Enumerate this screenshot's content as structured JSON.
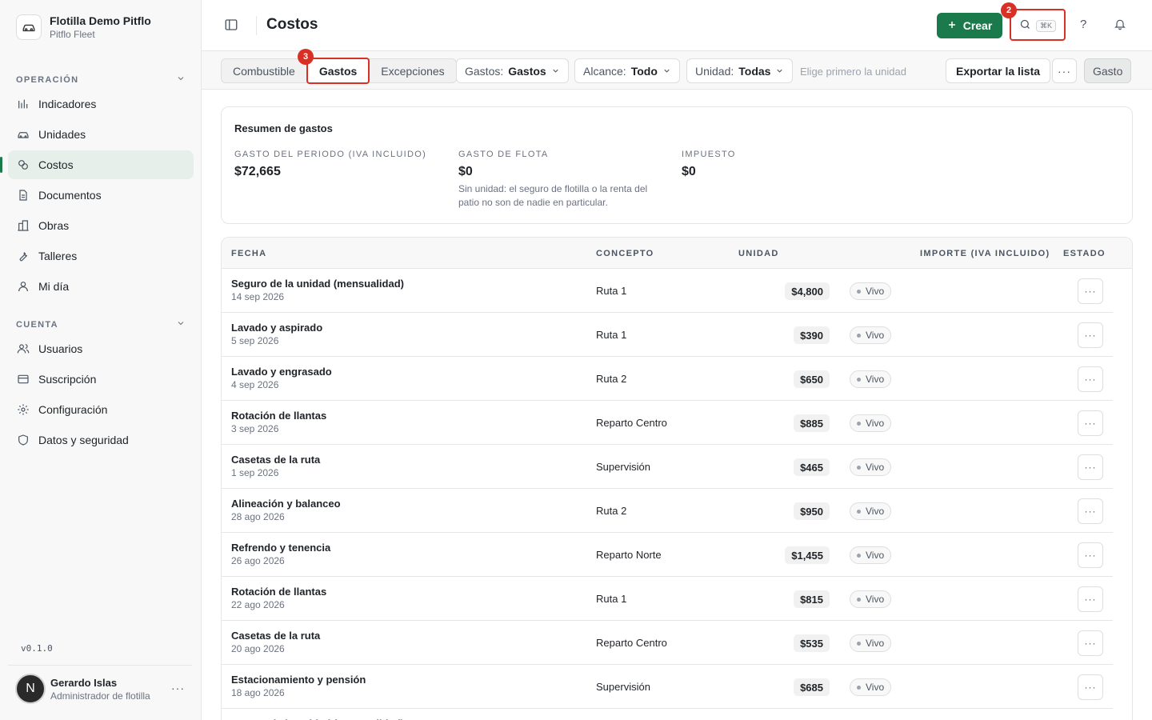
{
  "app": {
    "org_name": "Flotilla Demo Pitflo",
    "org_sub": "Pitflo Fleet",
    "version": "v0.1.0"
  },
  "sidebar": {
    "sections": [
      {
        "title": "OPERACIÓN",
        "items": [
          {
            "label": "Indicadores",
            "icon": "chart-icon",
            "active": false
          },
          {
            "label": "Unidades",
            "icon": "car-icon",
            "active": false
          },
          {
            "label": "Costos",
            "icon": "coins-icon",
            "active": true
          },
          {
            "label": "Documentos",
            "icon": "document-icon",
            "active": false
          },
          {
            "label": "Obras",
            "icon": "building-icon",
            "active": false
          },
          {
            "label": "Talleres",
            "icon": "wrench-icon",
            "active": false
          },
          {
            "label": "Mi día",
            "icon": "person-icon",
            "active": false
          }
        ]
      },
      {
        "title": "CUENTA",
        "items": [
          {
            "label": "Usuarios",
            "icon": "users-icon",
            "active": false
          },
          {
            "label": "Suscripción",
            "icon": "card-icon",
            "active": false
          },
          {
            "label": "Configuración",
            "icon": "gear-icon",
            "active": false
          },
          {
            "label": "Datos y seguridad",
            "icon": "shield-icon",
            "active": false
          }
        ]
      }
    ],
    "user": {
      "initial": "N",
      "name": "Gerardo Islas",
      "role": "Administrador de flotilla",
      "more": "···"
    }
  },
  "header": {
    "title": "Costos",
    "create_label": "Crear",
    "search_shortcut": "⌘K",
    "help_label": "?",
    "search_badge": "2",
    "tab_badge": "3"
  },
  "toolbar": {
    "tabs": [
      "Combustible",
      "Gastos",
      "Excepciones"
    ],
    "active_tab": "Gastos",
    "filters": [
      {
        "label": "Gastos:",
        "value": "Gastos"
      },
      {
        "label": "Alcance:",
        "value": "Todo"
      },
      {
        "label": "Unidad:",
        "value": "Todas"
      }
    ],
    "hint": "Elige primero la unidad",
    "export_label": "Exportar la lista",
    "more_label": "···",
    "gasto_label": "Gasto"
  },
  "summary": {
    "title": "Resumen de gastos",
    "metrics": [
      {
        "label": "GASTO DEL PERIODO (IVA INCLUIDO)",
        "value": "$72,665",
        "note": ""
      },
      {
        "label": "GASTO DE FLOTA",
        "value": "$0",
        "note": "Sin unidad: el seguro de flotilla o la renta del patio no son de nadie en particular."
      },
      {
        "label": "IMPUESTO",
        "value": "$0",
        "note": ""
      }
    ]
  },
  "table": {
    "columns": [
      "FECHA",
      "CONCEPTO",
      "UNIDAD",
      "IMPORTE (IVA INCLUIDO)",
      "ESTADO"
    ],
    "rows": [
      {
        "title": "Seguro de la unidad (mensualidad)",
        "date": "14 sep 2026",
        "unit": "Ruta 1",
        "amount": "$4,800",
        "status": "Vivo"
      },
      {
        "title": "Lavado y aspirado",
        "date": "5 sep 2026",
        "unit": "Ruta 1",
        "amount": "$390",
        "status": "Vivo"
      },
      {
        "title": "Lavado y engrasado",
        "date": "4 sep 2026",
        "unit": "Ruta 2",
        "amount": "$650",
        "status": "Vivo"
      },
      {
        "title": "Rotación de llantas",
        "date": "3 sep 2026",
        "unit": "Reparto Centro",
        "amount": "$885",
        "status": "Vivo"
      },
      {
        "title": "Casetas de la ruta",
        "date": "1 sep 2026",
        "unit": "Supervisión",
        "amount": "$465",
        "status": "Vivo"
      },
      {
        "title": "Alineación y balanceo",
        "date": "28 ago 2026",
        "unit": "Ruta 2",
        "amount": "$950",
        "status": "Vivo"
      },
      {
        "title": "Refrendo y tenencia",
        "date": "26 ago 2026",
        "unit": "Reparto Norte",
        "amount": "$1,455",
        "status": "Vivo"
      },
      {
        "title": "Rotación de llantas",
        "date": "22 ago 2026",
        "unit": "Ruta 1",
        "amount": "$815",
        "status": "Vivo"
      },
      {
        "title": "Casetas de la ruta",
        "date": "20 ago 2026",
        "unit": "Reparto Centro",
        "amount": "$535",
        "status": "Vivo"
      },
      {
        "title": "Estacionamiento y pensión",
        "date": "18 ago 2026",
        "unit": "Supervisión",
        "amount": "$685",
        "status": "Vivo"
      },
      {
        "title": "Seguro de la unidad (mensualidad)",
        "date": "",
        "unit": "",
        "amount": "",
        "status": ""
      }
    ],
    "row_more": "···"
  },
  "colors": {
    "accent": "#1a7a4c",
    "highlight": "#d93025"
  }
}
